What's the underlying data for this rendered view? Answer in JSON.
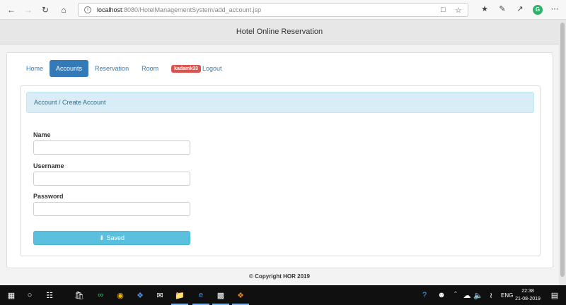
{
  "browser": {
    "url_host": "localhost",
    "url_path": ":8080/HotelManagementSystem/add_account.jsp"
  },
  "site": {
    "title": "Hotel Online Reservation"
  },
  "nav": {
    "home": "Home",
    "accounts": "Accounts",
    "reservation": "Reservation",
    "room": "Room",
    "user_badge": "kadamk33",
    "logout": "Logout"
  },
  "panel": {
    "breadcrumb": "Account / Create Account"
  },
  "form": {
    "name_label": "Name",
    "name_value": "",
    "username_label": "Username",
    "username_value": "",
    "password_label": "Password",
    "password_value": "",
    "save_label": "Saved"
  },
  "footer": {
    "copyright": "© Copyright HOR 2019"
  },
  "taskbar": {
    "language": "ENG",
    "time": "22:38",
    "date": "21-08-2019"
  },
  "colors": {
    "primary": "#337ab7",
    "info": "#5bc0de",
    "danger": "#d9534f",
    "breadcrumb_bg": "#d9edf7"
  }
}
